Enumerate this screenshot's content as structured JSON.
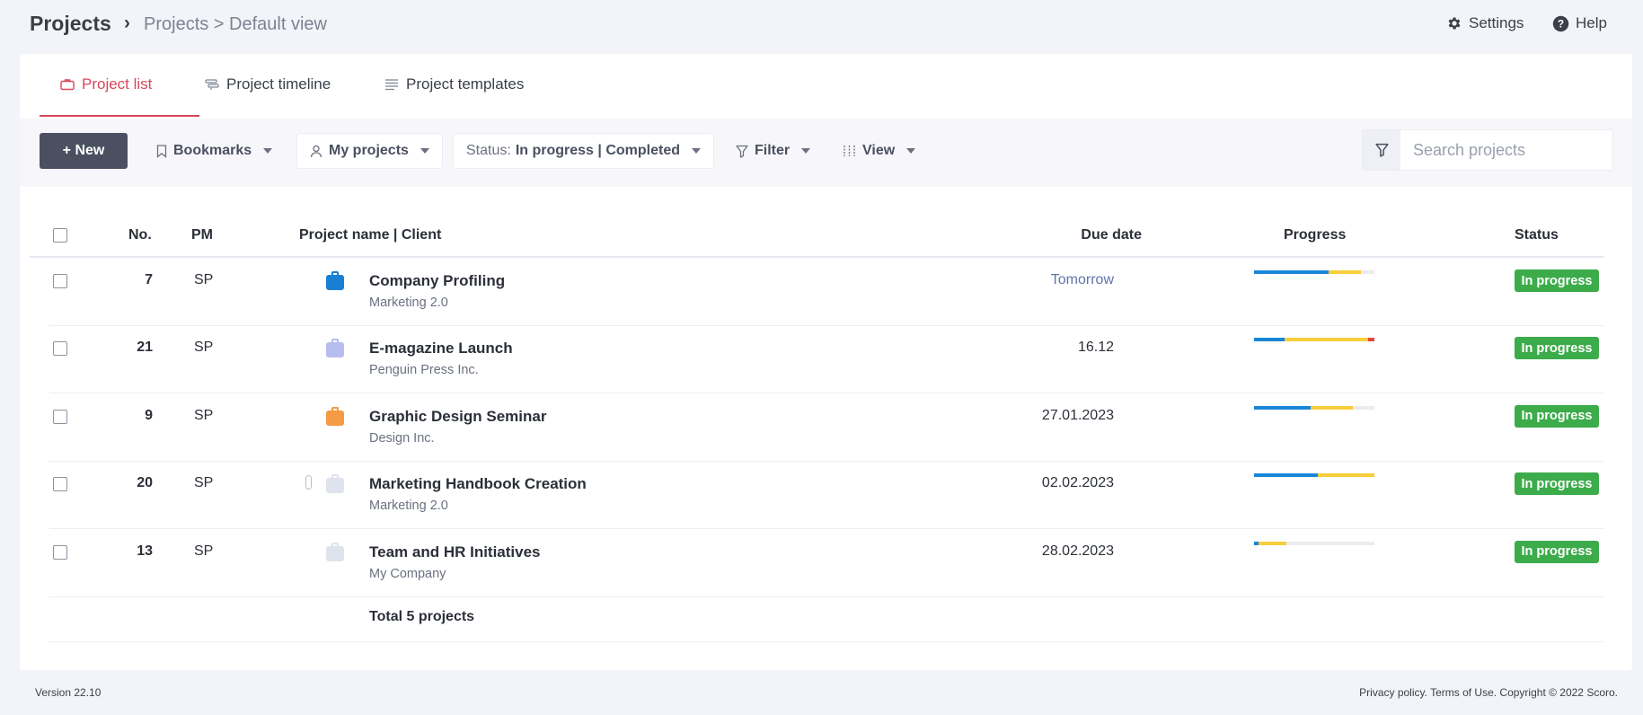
{
  "header": {
    "app_title": "Projects",
    "breadcrumb_sep": "›",
    "breadcrumb": "Projects > Default view",
    "settings_label": "Settings",
    "help_label": "Help"
  },
  "tabs": [
    {
      "label": "Project list",
      "icon": "briefcase-icon",
      "active": true
    },
    {
      "label": "Project timeline",
      "icon": "timeline-icon",
      "active": false
    },
    {
      "label": "Project templates",
      "icon": "list-icon",
      "active": false
    }
  ],
  "toolbar": {
    "new_label": "+ New",
    "bookmarks_label": "Bookmarks",
    "my_projects_label": "My projects",
    "status_prefix": "Status:",
    "status_value": "In progress | Completed",
    "filter_label": "Filter",
    "view_label": "View",
    "search_placeholder": "Search projects"
  },
  "table": {
    "headers": {
      "no": "No.",
      "pm": "PM",
      "project": "Project name | Client",
      "due": "Due date",
      "progress": "Progress",
      "status": "Status"
    },
    "rows": [
      {
        "no": "7",
        "pm": "SP",
        "name": "Company Profiling",
        "client": "Marketing 2.0",
        "due": "Tomorrow",
        "status": "In progress",
        "icon_color": "#1a7fd4",
        "progress": [
          {
            "pct": 62,
            "color": "#1a86d8"
          },
          {
            "pct": 27,
            "color": "#f7cd3c"
          }
        ],
        "attachment": false
      },
      {
        "no": "21",
        "pm": "SP",
        "name": "E-magazine Launch",
        "client": "Penguin Press Inc.",
        "due": "16.12",
        "status": "In progress",
        "icon_color": "#b7bcef",
        "progress": [
          {
            "pct": 25,
            "color": "#1a86d8"
          },
          {
            "pct": 70,
            "color": "#f7cd3c"
          },
          {
            "pct": 5,
            "color": "#e0463e"
          }
        ],
        "attachment": false
      },
      {
        "no": "9",
        "pm": "SP",
        "name": "Graphic Design Seminar",
        "client": "Design Inc.",
        "due": "27.01.2023",
        "status": "In progress",
        "icon_color": "#f59a45",
        "progress": [
          {
            "pct": 47,
            "color": "#1a86d8"
          },
          {
            "pct": 35,
            "color": "#f7cd3c"
          }
        ],
        "attachment": false
      },
      {
        "no": "20",
        "pm": "SP",
        "name": "Marketing Handbook Creation",
        "client": "Marketing 2.0",
        "due": "02.02.2023",
        "status": "In progress",
        "icon_color": "#dfe3ee",
        "progress": [
          {
            "pct": 53,
            "color": "#1a86d8"
          },
          {
            "pct": 47,
            "color": "#f7cd3c"
          }
        ],
        "attachment": true
      },
      {
        "no": "13",
        "pm": "SP",
        "name": "Team and HR Initiatives",
        "client": "My Company",
        "due": "28.02.2023",
        "status": "In progress",
        "icon_color": "#dfe3ee",
        "progress": [
          {
            "pct": 4,
            "color": "#1a86d8"
          },
          {
            "pct": 23,
            "color": "#f7cd3c"
          }
        ],
        "attachment": false
      }
    ],
    "total_label": "Total 5 projects"
  },
  "footer": {
    "version": "Version 22.10",
    "legal": "Privacy policy. Terms of Use. Copyright © 2022 Scoro."
  },
  "colors": {
    "accent": "#d8475a",
    "status_green": "#3cab4a",
    "new_button": "#4a5060"
  }
}
